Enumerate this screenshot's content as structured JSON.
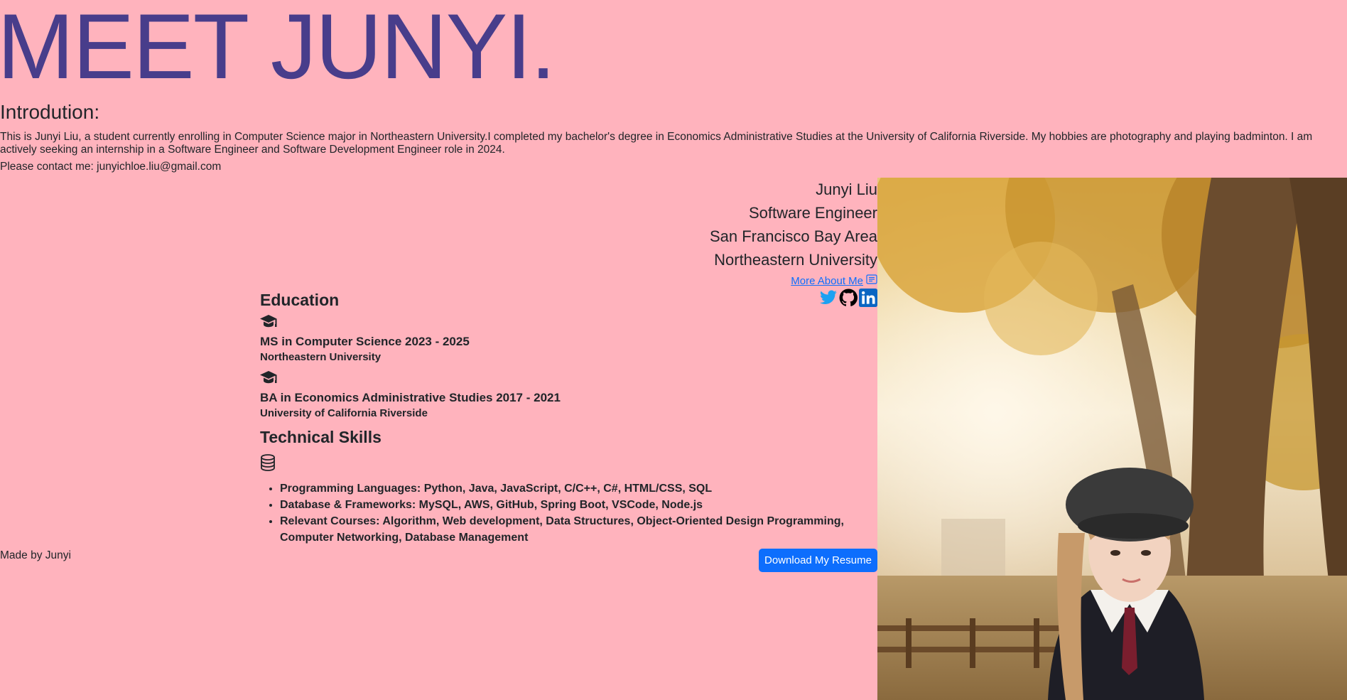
{
  "hero": {
    "title": "MEET JUNYI."
  },
  "intro": {
    "heading": "Introdution:",
    "text": "This is Junyi Liu, a student currently enrolling in Computer Science major in Northeastern University.I completed my bachelor's degree in Economics Administrative Studies at the University of California Riverside. My hobbies are photography and playing badminton. I am actively seeking an internship in a Software Engineer and Software Development Engineer role in 2024.",
    "contact": "Please contact me: junyichloe.liu@gmail.com"
  },
  "profile": {
    "name": "Junyi Liu",
    "role": "Software Engineer",
    "location": "San Francisco Bay Area",
    "school": "Northeastern University",
    "more_link": "More About Me"
  },
  "social": {
    "icons": [
      "twitter-icon",
      "github-icon",
      "linkedin-icon"
    ],
    "twitter_color": "#1da1f2",
    "github_color": "#000000",
    "linkedin_color": "#0a66c2"
  },
  "education": {
    "title": "Education",
    "items": [
      {
        "degree": "MS in Computer Science 2023 - 2025",
        "school": "Northeastern University"
      },
      {
        "degree": "BA in Economics Administrative Studies 2017 - 2021",
        "school": "University of California Riverside"
      }
    ]
  },
  "skills": {
    "title": "Technical Skills",
    "items": [
      "Programming Languages: Python, Java, JavaScript, C/C++, C#, HTML/CSS, SQL",
      "Database & Frameworks: MySQL, AWS, GitHub, Spring Boot, VSCode, Node.js",
      "Relevant Courses: Algorithm, Web development, Data Structures, Object-Oriented Design Programming, Computer Networking, Database Management"
    ]
  },
  "footer": {
    "made_by": "Made by Junyi",
    "resume_button": "Download My Resume"
  },
  "colors": {
    "background": "#ffb3bd",
    "title": "#483d8b",
    "accent": "#0d6efd"
  }
}
